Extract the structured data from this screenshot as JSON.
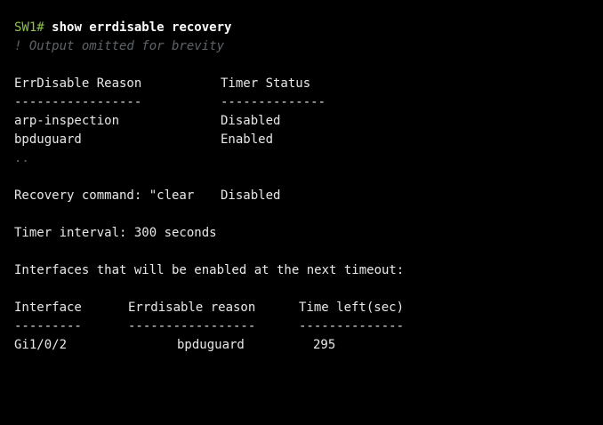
{
  "colors": {
    "background": "#000000",
    "text": "#e8e8e8",
    "prompt": "#8bc34a",
    "command": "#ffffff",
    "comment": "#5f6368"
  },
  "terminal": {
    "prompt": "SW1#",
    "command": "show errdisable recovery",
    "comment": "! Output omitted for brevity",
    "reason_table": {
      "headers": [
        "ErrDisable Reason",
        "Timer Status"
      ],
      "separators": [
        "-----------------",
        "--------------"
      ],
      "rows": [
        [
          "arp-inspection",
          "Disabled"
        ],
        [
          "bpduguard",
          "Enabled"
        ]
      ],
      "ellipsis": ".."
    },
    "recovery_command": {
      "label": "Recovery command: \"clear",
      "status": "Disabled"
    },
    "timer_interval": "Timer interval: 300 seconds",
    "interfaces_heading": "Interfaces that will be enabled at the next timeout:",
    "interfaces_table": {
      "headers": [
        "Interface",
        "Errdisable reason",
        "Time left(sec)"
      ],
      "separators": [
        "---------",
        "-----------------",
        "--------------"
      ],
      "rows": [
        [
          "Gi1/0/2",
          "bpduguard",
          "295"
        ]
      ]
    }
  }
}
